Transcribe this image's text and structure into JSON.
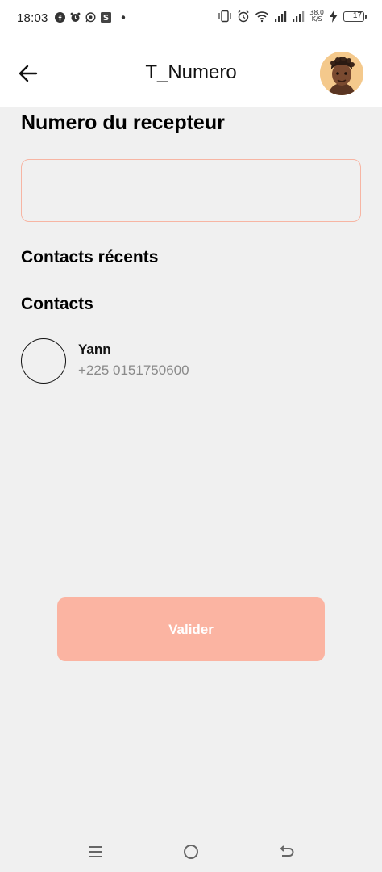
{
  "status_bar": {
    "time": "18:03",
    "net_speed_value": "38,0",
    "net_speed_unit": "K/S",
    "battery": "17",
    "left_icons": [
      "facebook-icon",
      "alarm-icon",
      "whatsapp-icon",
      "s-app-icon",
      "dot-icon"
    ],
    "right_icons": [
      "vibrate-icon",
      "alarm-icon",
      "wifi-icon",
      "signal-icon",
      "signal-icon",
      "charging-icon",
      "battery-icon"
    ]
  },
  "app_bar": {
    "back_icon": "arrow-left-icon",
    "title": "T_Numero",
    "avatar_icon": "memoji-avatar"
  },
  "form": {
    "receiver_heading": "Numero du recepteur",
    "receiver_value": "",
    "input_border_color": "#f7b5a3"
  },
  "sections": {
    "recent_contacts": "Contacts récents",
    "contacts": "Contacts"
  },
  "contacts": [
    {
      "name": "Yann",
      "phone": "+225 0151750600"
    }
  ],
  "actions": {
    "validate_label": "Valider",
    "validate_color": "#fbb4a2"
  },
  "nav_bar": {
    "icons": [
      "menu-icon",
      "home-icon",
      "back-icon"
    ]
  }
}
